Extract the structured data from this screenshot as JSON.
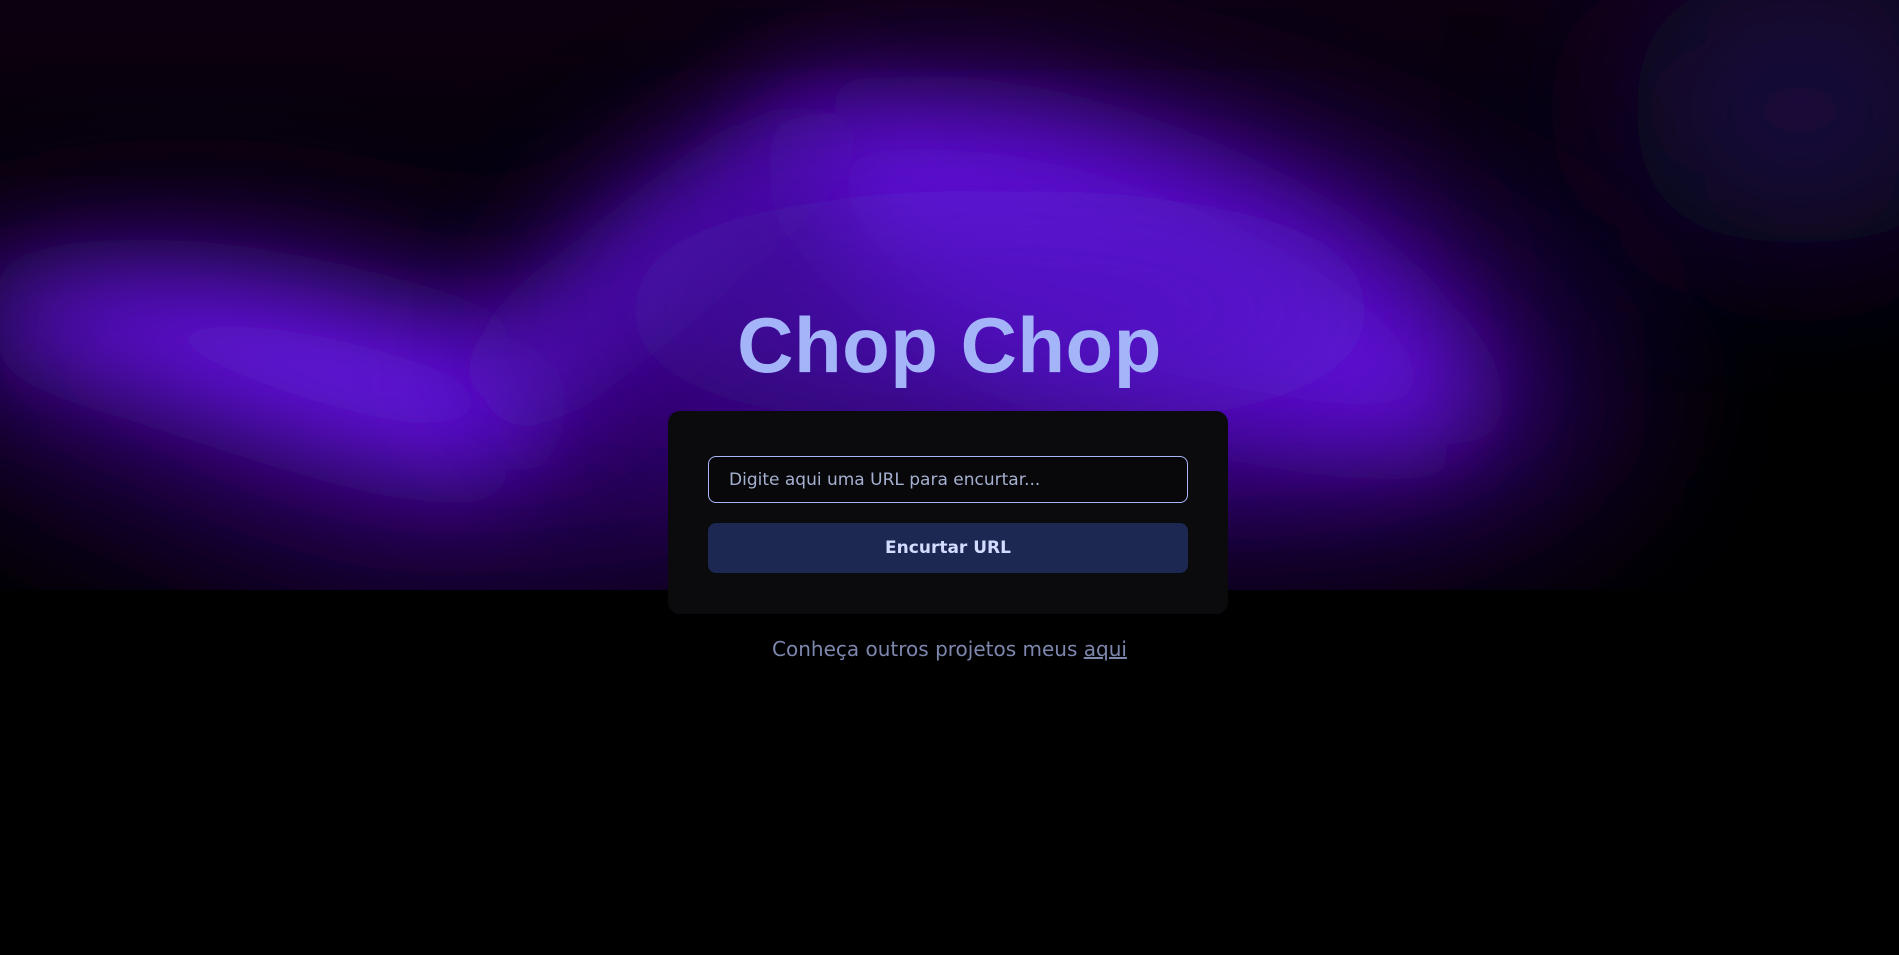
{
  "app": {
    "title": "Chop Chop"
  },
  "form": {
    "url_input": {
      "value": "",
      "placeholder": "Digite aqui uma URL para encurtar..."
    },
    "submit_label": "Encurtar URL"
  },
  "footer": {
    "text": "Conheça outros projetos meus ",
    "link_label": "aqui"
  },
  "colors": {
    "accent": "#6a18e8",
    "title": "#a3b4f8",
    "card_bg": "#0b0b0e",
    "button_bg": "#1c2752",
    "input_border": "#a7b6f4",
    "page_bg": "#000000"
  }
}
